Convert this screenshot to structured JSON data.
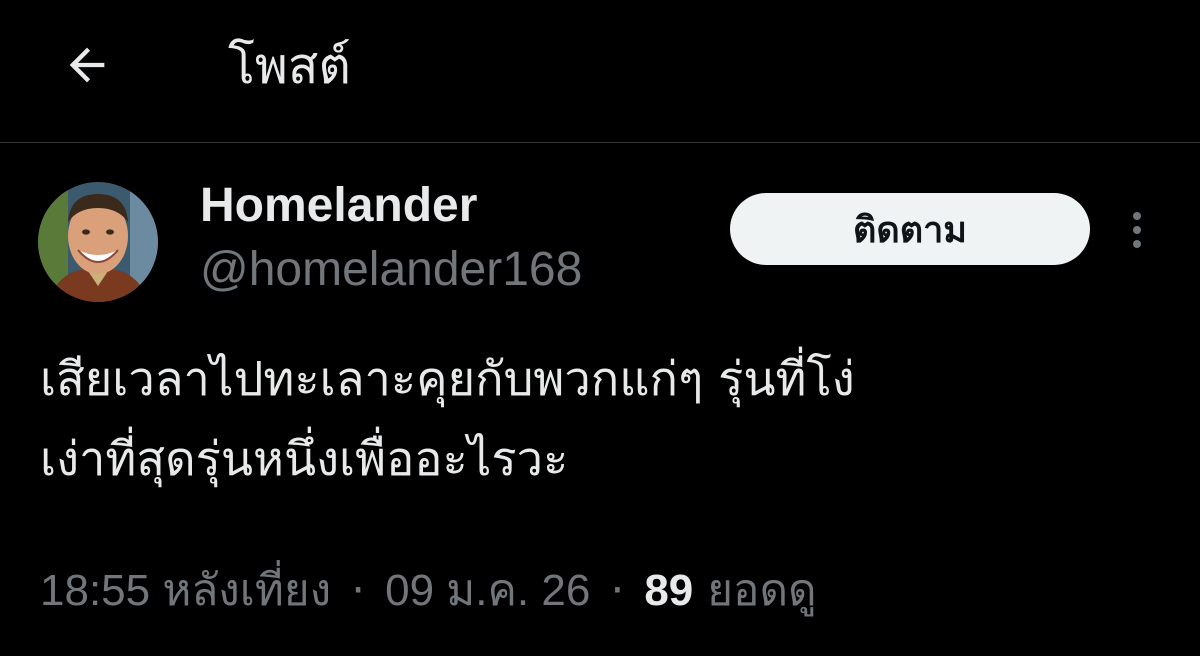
{
  "header": {
    "title": "โพสต์",
    "back_icon": "arrow-left-icon"
  },
  "author": {
    "display_name": "Homelander",
    "handle": "@homelander168",
    "follow_label": "ติดตาม",
    "more_icon": "more-vertical-icon",
    "avatar": "avatar-photo"
  },
  "post": {
    "text_line1": "เสียเวลาไปทะเลาะคุยกับพวกแก่ๆ รุ่นที่โง่",
    "text_line2": "เง่าที่สุดรุ่นหนึ่งเพื่ออะไรวะ"
  },
  "meta": {
    "time": "18:55 หลังเที่ยง",
    "separator": "·",
    "date": "09 ม.ค. 26",
    "views_count": "89",
    "views_label": "ยอดดู"
  },
  "colors": {
    "background": "#000000",
    "text_primary": "#e7e9ea",
    "text_secondary": "#71767b",
    "divider": "#2f3336",
    "follow_button_bg": "#eff3f4",
    "follow_button_text": "#0f1419"
  }
}
